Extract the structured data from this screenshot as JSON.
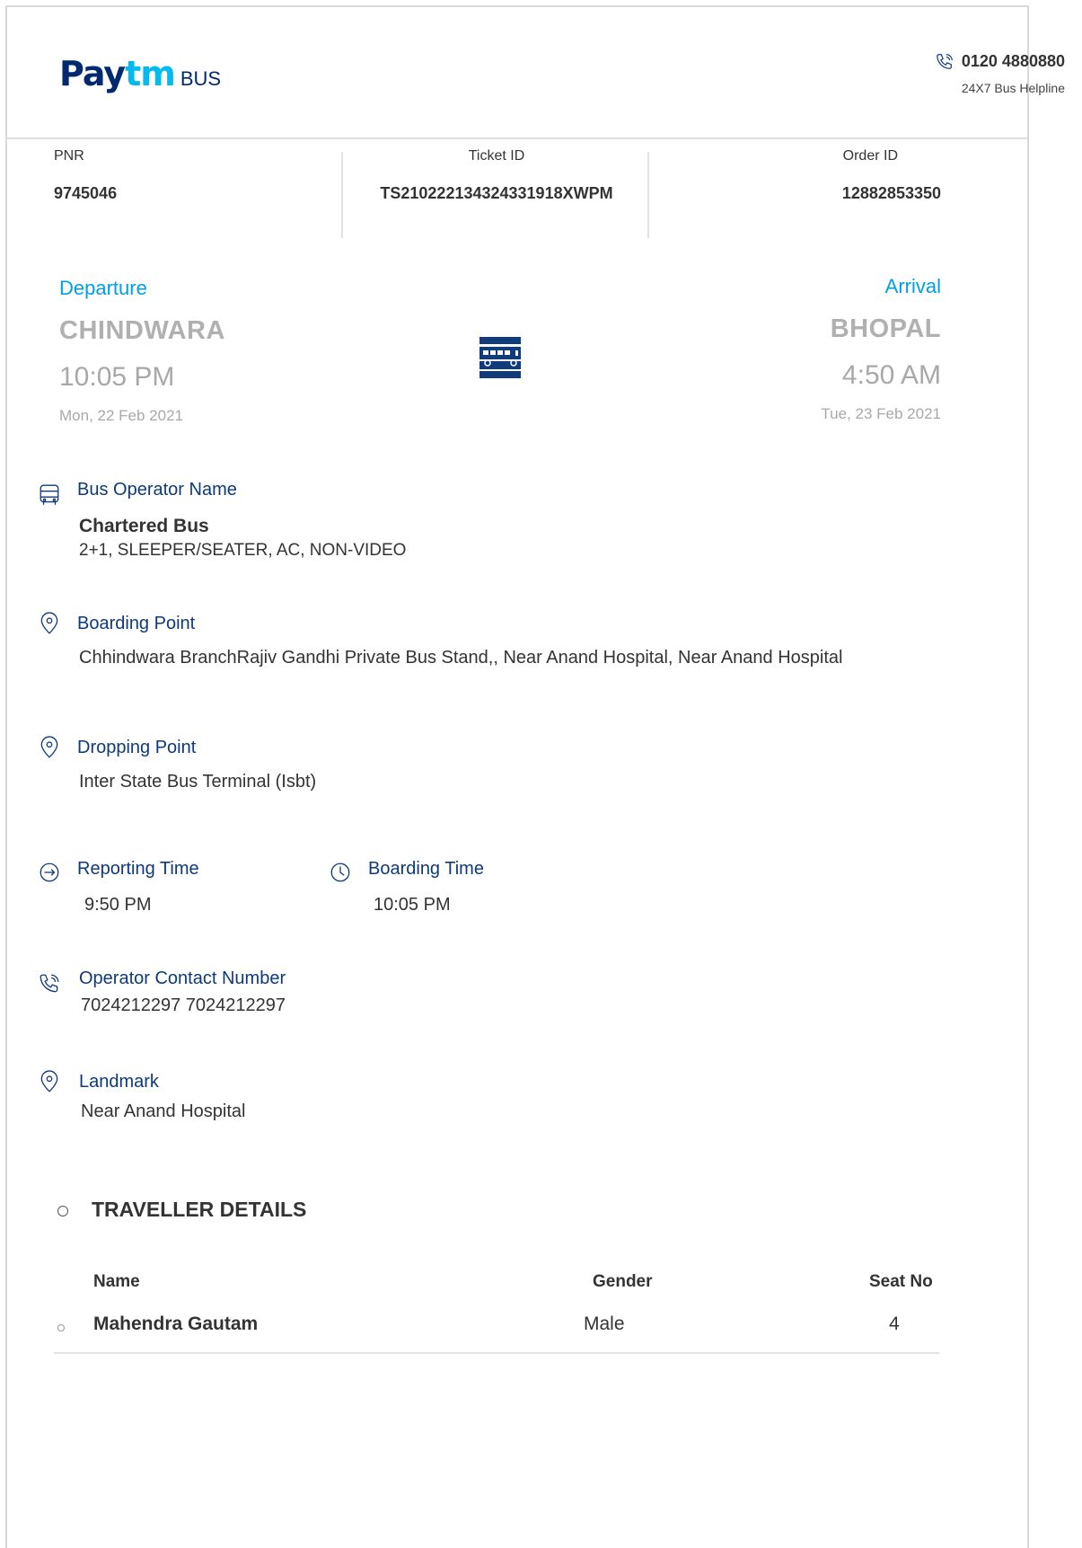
{
  "brand": {
    "name_pay": "Pay",
    "name_tm": "tm",
    "product": "BUS"
  },
  "helpline": {
    "number": "0120 4880880",
    "label": "24X7 Bus Helpline"
  },
  "ids": {
    "pnr_label": "PNR",
    "pnr": "9745046",
    "ticket_label": "Ticket ID",
    "ticket": "TS210222134324331918XWPM",
    "order_label": "Order ID",
    "order": "12882853350"
  },
  "departure": {
    "label": "Departure",
    "city": "CHINDWARA",
    "time": "10:05 PM",
    "date": "Mon, 22 Feb 2021"
  },
  "arrival": {
    "label": "Arrival",
    "city": "BHOPAL",
    "time": "4:50 AM",
    "date": "Tue, 23 Feb 2021"
  },
  "operator": {
    "title": "Bus Operator Name",
    "name": "Chartered Bus",
    "type": "2+1, SLEEPER/SEATER, AC, NON-VIDEO"
  },
  "boarding_point": {
    "title": "Boarding Point",
    "value": "Chhindwara BranchRajiv Gandhi Private Bus Stand,, Near Anand Hospital, Near Anand Hospital"
  },
  "dropping_point": {
    "title": "Dropping Point",
    "value": "Inter State Bus Terminal (Isbt)"
  },
  "reporting": {
    "title": "Reporting Time",
    "value": "9:50 PM"
  },
  "boarding_time": {
    "title": "Boarding Time",
    "value": "10:05 PM"
  },
  "contact": {
    "title": "Operator Contact Number",
    "value": "7024212297 7024212297"
  },
  "landmark": {
    "title": "Landmark",
    "value": "Near Anand Hospital"
  },
  "travellers": {
    "heading": "TRAVELLER DETAILS",
    "columns": [
      "Name",
      "Gender",
      "Seat No"
    ],
    "rows": [
      {
        "name": "Mahendra Gautam",
        "gender": "Male",
        "seat": "4"
      }
    ]
  },
  "colors": {
    "brand_navy": "#002970",
    "brand_cyan": "#00baf2",
    "label_blue": "#00a0e3",
    "title_navy": "#0e3a7a"
  }
}
